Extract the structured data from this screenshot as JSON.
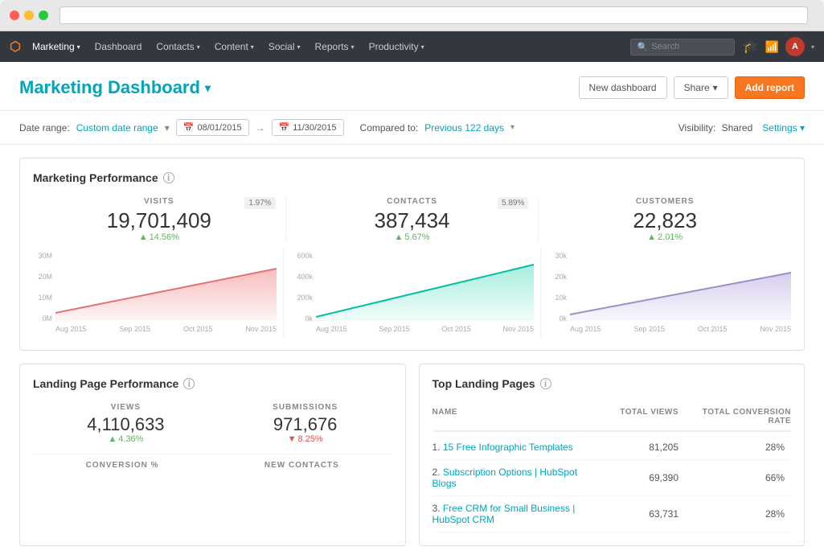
{
  "browser": {
    "dots": [
      "red",
      "yellow",
      "green"
    ]
  },
  "navbar": {
    "logo": "⚙",
    "items": [
      {
        "label": "Marketing",
        "has_chevron": true,
        "active": true
      },
      {
        "label": "Dashboard",
        "has_chevron": false
      },
      {
        "label": "Contacts",
        "has_chevron": true
      },
      {
        "label": "Content",
        "has_chevron": true
      },
      {
        "label": "Social",
        "has_chevron": true
      },
      {
        "label": "Reports",
        "has_chevron": true
      },
      {
        "label": "Productivity",
        "has_chevron": true
      }
    ],
    "search_placeholder": "Search",
    "avatar_text": "A"
  },
  "page_header": {
    "title": "Marketing Dashboard",
    "chevron": "▾",
    "buttons": {
      "new_dashboard": "New dashboard",
      "share": "Share",
      "add_report": "Add report"
    }
  },
  "filter_bar": {
    "date_range_label": "Date range:",
    "date_range_link": "Custom date range",
    "date_from": "08/01/2015",
    "date_to": "11/30/2015",
    "compared_label": "Compared to:",
    "compared_link": "Previous 122 days",
    "visibility_label": "Visibility:",
    "visibility_value": "Shared",
    "settings_label": "Settings"
  },
  "marketing_performance": {
    "title": "Marketing Performance",
    "metrics": [
      {
        "label": "VISITS",
        "value": "19,701,409",
        "change": "14.56%",
        "direction": "up",
        "badge": "1.97%",
        "chart_color": "#f4a0a0",
        "chart_stroke": "#e57373"
      },
      {
        "label": "CONTACTS",
        "value": "387,434",
        "change": "5.67%",
        "direction": "up",
        "badge": "5.89%",
        "chart_color": "#80e8d0",
        "chart_stroke": "#00bfa5"
      },
      {
        "label": "CUSTOMERS",
        "value": "22,823",
        "change": "2.01%",
        "direction": "up",
        "badge": null,
        "chart_color": "#c5b8e8",
        "chart_stroke": "#9c8ec7"
      }
    ],
    "x_labels": [
      "Aug 2015",
      "Sep 2015",
      "Oct 2015",
      "Nov 2015"
    ],
    "y_labels_visits": [
      "30M",
      "20M",
      "10M",
      "0M"
    ],
    "y_labels_contacts": [
      "600k",
      "400k",
      "200k",
      "0k"
    ],
    "y_labels_customers": [
      "30k",
      "20k",
      "10k",
      "0k"
    ]
  },
  "landing_page_performance": {
    "title": "Landing Page Performance",
    "metrics": [
      {
        "label": "VIEWS",
        "value": "4,110,633",
        "change": "4.36%",
        "direction": "up"
      },
      {
        "label": "SUBMISSIONS",
        "value": "971,676",
        "change": "8.25%",
        "direction": "down"
      }
    ],
    "bottom_labels": [
      "CONVERSION %",
      "NEW CONTACTS"
    ]
  },
  "top_landing_pages": {
    "title": "Top Landing Pages",
    "columns": [
      "NAME",
      "TOTAL VIEWS",
      "TOTAL CONVERSION RATE"
    ],
    "rows": [
      {
        "rank": "1.",
        "name": "15 Free Infographic Templates",
        "views": "81,205",
        "rate": "28%"
      },
      {
        "rank": "2.",
        "name": "Subscription Options | HubSpot Blogs",
        "views": "69,390",
        "rate": "66%"
      },
      {
        "rank": "3.",
        "name": "Free CRM for Small Business | HubSpot CRM",
        "views": "63,731",
        "rate": "28%"
      }
    ]
  }
}
